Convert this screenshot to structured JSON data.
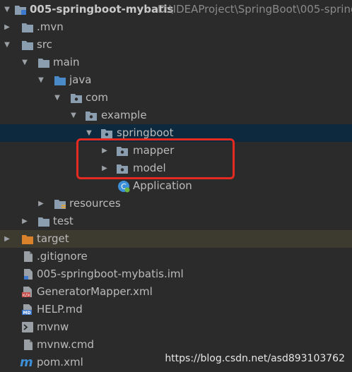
{
  "project": {
    "name": "005-springboot-mybatis",
    "path": "D:\\IDEAProject\\SpringBoot\\005-spring"
  },
  "tree": {
    "mvn": ".mvn",
    "src": "src",
    "main": "main",
    "java": "java",
    "com": "com",
    "example": "example",
    "springboot": "springboot",
    "mapper": "mapper",
    "model": "model",
    "application": "Application",
    "resources": "resources",
    "test": "test",
    "target": "target",
    "gitignore": ".gitignore",
    "iml": "005-springboot-mybatis.iml",
    "generator": "GeneratorMapper.xml",
    "help": "HELP.md",
    "mvnw": "mvnw",
    "mvnwcmd": "mvnw.cmd",
    "pom": "pom.xml"
  },
  "watermark": "https://blog.csdn.net/asd893103762",
  "colors": {
    "background": "#2b2b2b",
    "selected": "#0d293e",
    "excluded": "#3d3b2f",
    "highlight": "#e52a21",
    "folder": "#8a9eb0",
    "target_folder": "#d9822b"
  }
}
